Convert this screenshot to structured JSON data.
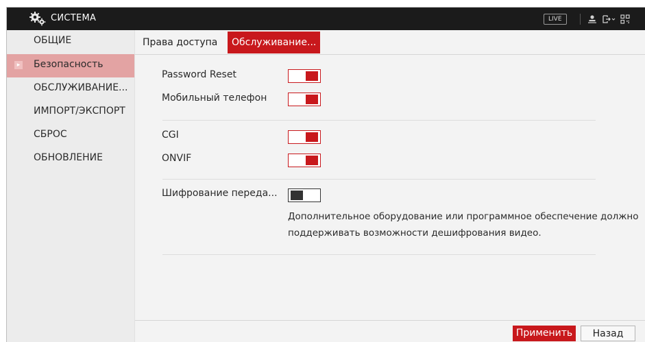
{
  "header": {
    "title": "СИСТЕМА",
    "live_badge": "LIVE",
    "icons": [
      "gear-icon",
      "user-icon",
      "logout-icon",
      "qr-icon"
    ]
  },
  "sidebar": {
    "items": [
      {
        "label": "ОБЩИЕ",
        "active": false
      },
      {
        "label": "Безопасность",
        "active": true
      },
      {
        "label": "ОБСЛУЖИВАНИЕ...",
        "active": false
      },
      {
        "label": "ИМПОРТ/ЭКСПОРТ",
        "active": false
      },
      {
        "label": "СБРОС",
        "active": false
      },
      {
        "label": "ОБНОВЛЕНИЕ",
        "active": false
      }
    ]
  },
  "tabs": [
    {
      "label": "Права доступа",
      "active": false
    },
    {
      "label": "Обслуживание...",
      "active": true
    }
  ],
  "settings": {
    "password_reset": {
      "label": "Password Reset",
      "enabled": true
    },
    "mobile_phone": {
      "label": "Мобильный телефон",
      "enabled": true
    },
    "cgi": {
      "label": "CGI",
      "enabled": true
    },
    "onvif": {
      "label": "ONVIF",
      "enabled": true
    },
    "encryption": {
      "label": "Шифрование переда...",
      "enabled": false
    },
    "note_line1": "Дополнительное оборудование или программное обеспечение должно",
    "note_line2": "поддерживать возможности дешифрования видео."
  },
  "footer": {
    "apply_label": "Применить",
    "back_label": "Назад"
  },
  "colors": {
    "accent": "#c8181c",
    "topbar": "#1b1b1b",
    "sidebar_active": "#e3a3a3"
  }
}
